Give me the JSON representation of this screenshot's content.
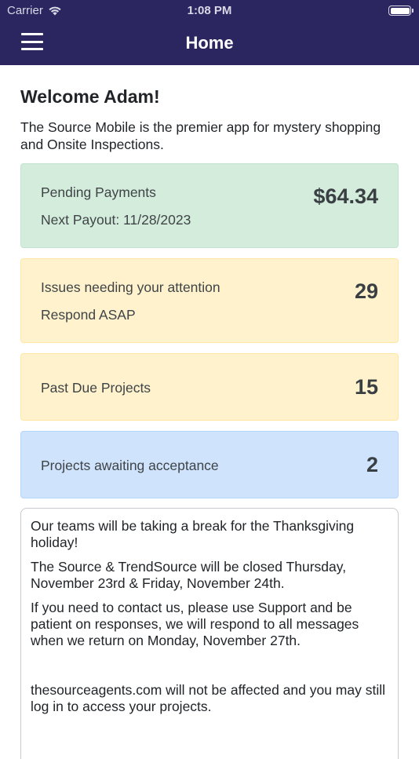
{
  "status_bar": {
    "carrier": "Carrier",
    "time": "1:08 PM"
  },
  "nav": {
    "title": "Home",
    "menu_icon": "hamburger-menu-icon"
  },
  "welcome": {
    "title": "Welcome Adam!",
    "intro": "The Source Mobile is the premier app for mystery shopping and Onsite Inspections."
  },
  "cards": {
    "pending": {
      "label": "Pending Payments",
      "sublabel": "Next Payout: 11/28/2023",
      "value": "$64.34",
      "color": "#d4ecdc"
    },
    "issues": {
      "label": "Issues needing your attention",
      "sublabel": "Respond ASAP",
      "value": "29",
      "color": "#fff2cc"
    },
    "past_due": {
      "label": "Past Due Projects",
      "value": "15",
      "color": "#fff2cc"
    },
    "awaiting": {
      "label": "Projects awaiting acceptance",
      "value": "2",
      "color": "#cfe3fc"
    }
  },
  "notice": {
    "p1": "Our teams will be taking a break for the Thanksgiving holiday!",
    "p2": "The Source & TrendSource will be closed Thursday, November 23rd & Friday, November 24th.",
    "p3": "If you need to contact us, please use Support and be patient on responses, we will respond to all messages when we return on Monday, November 27th.",
    "p4": "thesourceagents.com will not be affected and you may still log in to access your projects."
  },
  "colors": {
    "nav_background": "#2b2660"
  }
}
